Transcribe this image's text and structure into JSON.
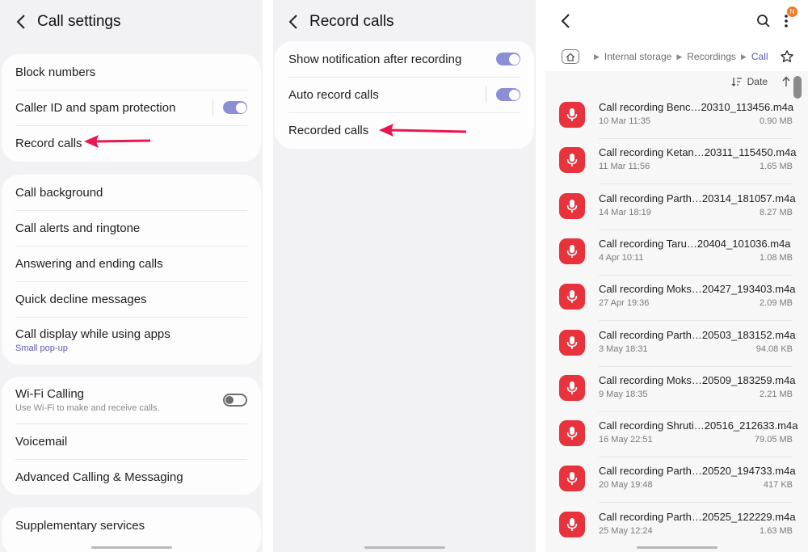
{
  "colors": {
    "accent": "#8d8fd6",
    "link": "#5a5bb5",
    "arrow": "#e8174e",
    "record_icon_bg": "#e8323c",
    "badge": "#f07a2a"
  },
  "panel1": {
    "title": "Call settings",
    "group1": [
      {
        "label": "Block numbers"
      },
      {
        "label": "Caller ID and spam protection",
        "toggle": "on"
      },
      {
        "label": "Record calls"
      }
    ],
    "group2": [
      {
        "label": "Call background"
      },
      {
        "label": "Call alerts and ringtone"
      },
      {
        "label": "Answering and ending calls"
      },
      {
        "label": "Quick decline messages"
      },
      {
        "label": "Call display while using apps",
        "sub": "Small pop-up"
      }
    ],
    "group3": [
      {
        "label": "Wi-Fi Calling",
        "sub": "Use Wi-Fi to make and receive calls.",
        "toggle": "off"
      },
      {
        "label": "Voicemail"
      },
      {
        "label": "Advanced Calling & Messaging"
      }
    ],
    "group4": [
      {
        "label": "Supplementary services"
      }
    ]
  },
  "panel2": {
    "title": "Record calls",
    "items": [
      {
        "label": "Show notification after recording",
        "toggle": "on"
      },
      {
        "label": "Auto record calls",
        "toggle": "on"
      },
      {
        "label": "Recorded calls"
      }
    ]
  },
  "panel3": {
    "badge": "N",
    "breadcrumb": [
      "Internal storage",
      "Recordings",
      "Call"
    ],
    "sort_label": "Date",
    "files": [
      {
        "name": "Call recording Benc…20310_113456.m4a",
        "date": "10 Mar 11:35",
        "size": "0.90 MB"
      },
      {
        "name": "Call recording Ketan…20311_115450.m4a",
        "date": "11 Mar 11:56",
        "size": "1.65 MB"
      },
      {
        "name": "Call recording Parth…20314_181057.m4a",
        "date": "14 Mar 18:19",
        "size": "8.27 MB"
      },
      {
        "name": "Call recording Taru…20404_101036.m4a",
        "date": "4 Apr 10:11",
        "size": "1.08 MB"
      },
      {
        "name": "Call recording Moks…20427_193403.m4a",
        "date": "27 Apr 19:36",
        "size": "2.09 MB"
      },
      {
        "name": "Call recording Parth…20503_183152.m4a",
        "date": "3 May 18:31",
        "size": "94.08 KB"
      },
      {
        "name": "Call recording Moks…20509_183259.m4a",
        "date": "9 May 18:35",
        "size": "2.21 MB"
      },
      {
        "name": "Call recording Shruti…20516_212633.m4a",
        "date": "16 May 22:51",
        "size": "79.05 MB"
      },
      {
        "name": "Call recording Parth…20520_194733.m4a",
        "date": "20 May 19:48",
        "size": "417 KB"
      },
      {
        "name": "Call recording Parth…20525_122229.m4a",
        "date": "25 May 12:24",
        "size": "1.63 MB"
      }
    ]
  }
}
